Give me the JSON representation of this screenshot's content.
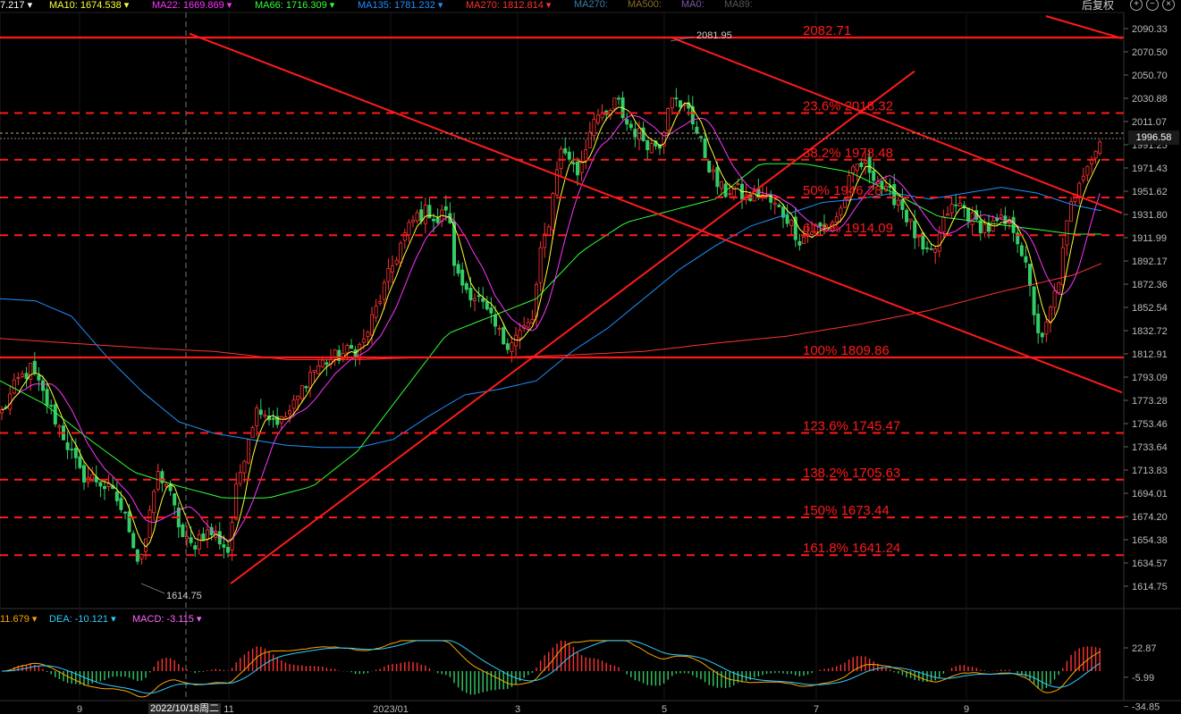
{
  "toolbar": {
    "rights_label": "后复权",
    "zoom_in_icon": "plus-circle-icon",
    "zoom_out_icon": "minus-circle-icon",
    "close_icon": "close-circle-icon"
  },
  "ma_legend": [
    {
      "text": "7.217",
      "color": "#ffffff",
      "x": 0
    },
    {
      "text": "MA10:",
      "value": "1674.538",
      "color": "#ffff33",
      "x": 55
    },
    {
      "text": "MA22:",
      "value": "1669.869",
      "color": "#ff33ff",
      "x": 170
    },
    {
      "text": "MA66:",
      "value": "1716.309",
      "color": "#33ff33",
      "x": 285
    },
    {
      "text": "MA135:",
      "value": "1781.232",
      "color": "#1e90ff",
      "x": 400
    },
    {
      "text": "MA270:",
      "value": "1812.814",
      "color": "#ff3333",
      "x": 521
    },
    {
      "text": "MA270:",
      "value": "",
      "color": "#3a7fa8",
      "x": 642
    },
    {
      "text": "MA500:",
      "value": "",
      "color": "#8b6d2a",
      "x": 702
    },
    {
      "text": "MA0:",
      "value": "",
      "color": "#7a5aa8",
      "x": 762
    },
    {
      "text": "MA89:",
      "value": "",
      "color": "#555555",
      "x": 810
    }
  ],
  "macd_legend": [
    {
      "text": "11.679",
      "color": "#ffa500"
    },
    {
      "text": "DEA:",
      "value": "-10.121",
      "color": "#33ccff"
    },
    {
      "text": "MACD:",
      "value": "-3.115",
      "color": "#ff66ff"
    }
  ],
  "current_price": "1996.58",
  "cursor_date": "2022/10/18周二",
  "chart_data": {
    "type": "candlestick",
    "price_axis": {
      "ylim": [
        1614.75,
        2090.33
      ],
      "ticks": [
        "2090.33",
        "2070.50",
        "2050.70",
        "2030.88",
        "2011.07",
        "1991.25",
        "1971.43",
        "1951.62",
        "1931.80",
        "1911.99",
        "1892.17",
        "1872.36",
        "1852.54",
        "1832.72",
        "1812.91",
        "1793.09",
        "1773.28",
        "1753.46",
        "1733.64",
        "1713.83",
        "1694.01",
        "1674.20",
        "1654.38",
        "1634.57",
        "1614.75"
      ]
    },
    "macd_axis": {
      "ticks": [
        "22.87",
        "-5.99",
        "-34.85"
      ]
    },
    "x_labels": [
      {
        "label": "9",
        "x": 89
      },
      {
        "label": "11",
        "x": 256
      },
      {
        "label": "2023/01",
        "x": 437
      },
      {
        "label": "3",
        "x": 579
      },
      {
        "label": "5",
        "x": 743
      },
      {
        "label": "7",
        "x": 913
      },
      {
        "label": "9",
        "x": 1081
      }
    ],
    "extremes": [
      {
        "label": "2081.95",
        "kind": "high"
      },
      {
        "label": "1614.75",
        "kind": "low"
      }
    ],
    "fib_levels": [
      {
        "label": "2082.71",
        "price": 2082.71,
        "solid": true
      },
      {
        "label": "23.6% 2018.32",
        "price": 2018.32,
        "solid": false
      },
      {
        "label": "38.2% 1978.48",
        "price": 1978.48,
        "solid": false
      },
      {
        "label": "50% 1946.28",
        "price": 1946.28,
        "solid": false
      },
      {
        "label": "61.8% 1914.09",
        "price": 1914.09,
        "solid": false
      },
      {
        "label": "100% 1809.86",
        "price": 1809.86,
        "solid": true
      },
      {
        "label": "123.6% 1745.47",
        "price": 1745.47,
        "solid": false
      },
      {
        "label": "138.2% 1705.63",
        "price": 1705.63,
        "solid": false
      },
      {
        "label": "150% 1673.44",
        "price": 1673.44,
        "solid": false
      },
      {
        "label": "161.8% 1641.24",
        "price": 1641.24,
        "solid": false
      }
    ],
    "close_waypoints": [
      [
        0,
        1760
      ],
      [
        20,
        1790
      ],
      [
        35,
        1800
      ],
      [
        50,
        1775
      ],
      [
        70,
        1745
      ],
      [
        90,
        1710
      ],
      [
        110,
        1705
      ],
      [
        130,
        1690
      ],
      [
        145,
        1665
      ],
      [
        155,
        1635
      ],
      [
        165,
        1660
      ],
      [
        175,
        1710
      ],
      [
        185,
        1705
      ],
      [
        195,
        1680
      ],
      [
        205,
        1655
      ],
      [
        215,
        1648
      ],
      [
        225,
        1660
      ],
      [
        240,
        1660
      ],
      [
        255,
        1645
      ],
      [
        265,
        1700
      ],
      [
        280,
        1750
      ],
      [
        290,
        1770
      ],
      [
        300,
        1760
      ],
      [
        315,
        1755
      ],
      [
        330,
        1770
      ],
      [
        345,
        1795
      ],
      [
        360,
        1805
      ],
      [
        375,
        1810
      ],
      [
        390,
        1815
      ],
      [
        405,
        1820
      ],
      [
        420,
        1850
      ],
      [
        435,
        1880
      ],
      [
        450,
        1910
      ],
      [
        465,
        1930
      ],
      [
        480,
        1935
      ],
      [
        490,
        1925
      ],
      [
        500,
        1940
      ],
      [
        510,
        1880
      ],
      [
        520,
        1870
      ],
      [
        535,
        1860
      ],
      [
        550,
        1840
      ],
      [
        565,
        1822
      ],
      [
        580,
        1830
      ],
      [
        595,
        1840
      ],
      [
        605,
        1900
      ],
      [
        615,
        1930
      ],
      [
        625,
        1985
      ],
      [
        635,
        1985
      ],
      [
        645,
        1965
      ],
      [
        655,
        1990
      ],
      [
        665,
        2020
      ],
      [
        675,
        2010
      ],
      [
        690,
        2030
      ],
      [
        700,
        2010
      ],
      [
        715,
        2000
      ],
      [
        730,
        1990
      ],
      [
        740,
        1995
      ],
      [
        750,
        2040
      ],
      [
        760,
        2020
      ],
      [
        770,
        2025
      ],
      [
        780,
        2000
      ],
      [
        790,
        1980
      ],
      [
        800,
        1960
      ],
      [
        810,
        1950
      ],
      [
        820,
        1955
      ],
      [
        835,
        1945
      ],
      [
        850,
        1950
      ],
      [
        865,
        1940
      ],
      [
        880,
        1930
      ],
      [
        895,
        1910
      ],
      [
        910,
        1920
      ],
      [
        925,
        1920
      ],
      [
        940,
        1935
      ],
      [
        950,
        1960
      ],
      [
        960,
        1975
      ],
      [
        975,
        1970
      ],
      [
        990,
        1950
      ],
      [
        1005,
        1945
      ],
      [
        1020,
        1920
      ],
      [
        1035,
        1895
      ],
      [
        1045,
        1900
      ],
      [
        1060,
        1935
      ],
      [
        1075,
        1940
      ],
      [
        1090,
        1925
      ],
      [
        1105,
        1920
      ],
      [
        1120,
        1925
      ],
      [
        1135,
        1920
      ],
      [
        1145,
        1895
      ],
      [
        1155,
        1855
      ],
      [
        1165,
        1820
      ],
      [
        1175,
        1850
      ],
      [
        1185,
        1880
      ],
      [
        1195,
        1930
      ],
      [
        1205,
        1960
      ],
      [
        1215,
        1975
      ],
      [
        1225,
        1985
      ],
      [
        1232,
        1996.58
      ]
    ],
    "overlays": {
      "ma135_waypoints": [
        [
          0,
          1860
        ],
        [
          40,
          1858
        ],
        [
          80,
          1845
        ],
        [
          120,
          1810
        ],
        [
          160,
          1780
        ],
        [
          200,
          1755
        ],
        [
          240,
          1745
        ],
        [
          280,
          1740
        ],
        [
          320,
          1735
        ],
        [
          360,
          1733
        ],
        [
          400,
          1733
        ],
        [
          440,
          1740
        ],
        [
          480,
          1760
        ],
        [
          520,
          1778
        ],
        [
          560,
          1783
        ],
        [
          600,
          1790
        ],
        [
          640,
          1815
        ],
        [
          680,
          1835
        ],
        [
          720,
          1860
        ],
        [
          760,
          1885
        ],
        [
          800,
          1905
        ],
        [
          840,
          1922
        ],
        [
          880,
          1932
        ],
        [
          920,
          1942
        ],
        [
          960,
          1945
        ],
        [
          1000,
          1950
        ],
        [
          1040,
          1945
        ],
        [
          1080,
          1950
        ],
        [
          1120,
          1955
        ],
        [
          1160,
          1950
        ],
        [
          1200,
          1940
        ],
        [
          1232,
          1935
        ]
      ],
      "ma270_waypoints": [
        [
          0,
          1826
        ],
        [
          80,
          1822
        ],
        [
          160,
          1818
        ],
        [
          240,
          1815
        ],
        [
          320,
          1808
        ],
        [
          400,
          1808
        ],
        [
          480,
          1810
        ],
        [
          560,
          1810
        ],
        [
          640,
          1812
        ],
        [
          720,
          1815
        ],
        [
          800,
          1822
        ],
        [
          880,
          1828
        ],
        [
          960,
          1838
        ],
        [
          1040,
          1850
        ],
        [
          1120,
          1866
        ],
        [
          1200,
          1880
        ],
        [
          1232,
          1890
        ]
      ],
      "ma66_waypoints": [
        [
          0,
          1790
        ],
        [
          50,
          1770
        ],
        [
          100,
          1740
        ],
        [
          150,
          1712
        ],
        [
          200,
          1700
        ],
        [
          250,
          1690
        ],
        [
          300,
          1690
        ],
        [
          350,
          1700
        ],
        [
          400,
          1730
        ],
        [
          450,
          1780
        ],
        [
          500,
          1830
        ],
        [
          550,
          1845
        ],
        [
          600,
          1860
        ],
        [
          650,
          1900
        ],
        [
          700,
          1925
        ],
        [
          750,
          1935
        ],
        [
          800,
          1945
        ],
        [
          850,
          1975
        ],
        [
          900,
          1975
        ],
        [
          950,
          1968
        ],
        [
          1000,
          1950
        ],
        [
          1050,
          1930
        ],
        [
          1100,
          1925
        ],
        [
          1150,
          1920
        ],
        [
          1200,
          1915
        ],
        [
          1232,
          1915
        ]
      ]
    },
    "trend_lines": [
      {
        "from": [
          212,
          2086
        ],
        "to": [
          1255,
          1780
        ]
      },
      {
        "from": [
          258,
          1617
        ],
        "to": [
          1023,
          2054
        ]
      },
      {
        "from": [
          750,
          2083
        ],
        "to": [
          1255,
          1933
        ]
      },
      {
        "from": [
          1170,
          2101
        ],
        "to": [
          1255,
          2082
        ]
      }
    ],
    "ma_colors": {
      "ma10": "#ffff33",
      "ma22": "#ff33ff",
      "ma66": "#33ff33",
      "ma135": "#1e90ff",
      "ma270": "#ff3333"
    },
    "up_color": "#ff3333",
    "down_color": "#33cc66",
    "fib_color": "#ff1a1a"
  }
}
